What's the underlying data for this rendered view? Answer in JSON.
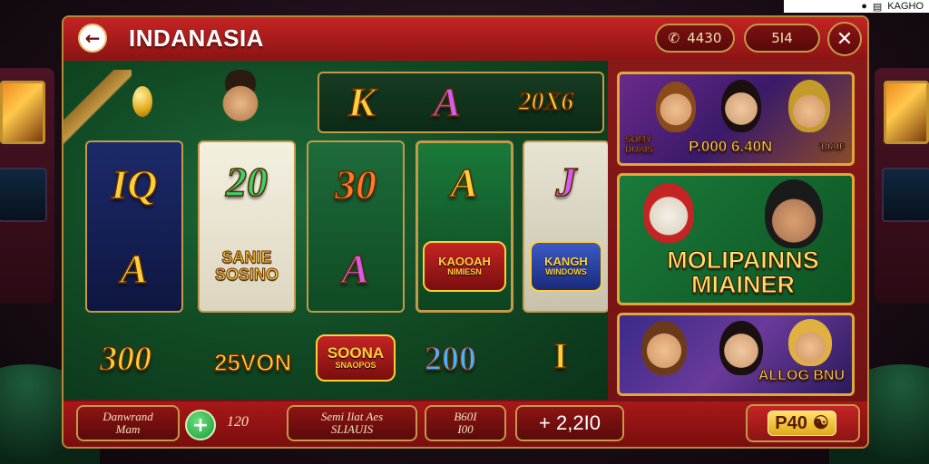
{
  "status_bar": {
    "text": "KAGHO"
  },
  "header": {
    "title": "INDANASIA",
    "phone_pill": "4430",
    "users_pill": "5I4",
    "icons": {
      "back": "back-arrow-icon",
      "close": "close-icon",
      "phone": "phone-icon",
      "user": "user-icon"
    }
  },
  "slot": {
    "top_row": [
      "K",
      "A",
      "20X6"
    ],
    "reels": [
      [
        "IQ",
        "A"
      ],
      [
        "20",
        "SANIE",
        "SOSINO"
      ],
      [
        "30",
        "A"
      ],
      [
        "A",
        "KAOOAH",
        "NIMIESN"
      ],
      [
        "J",
        "KANGH",
        "WINDOWS"
      ]
    ],
    "bottom_row": [
      "300",
      "25VON",
      "SOONA",
      "SNAOPOS",
      "200",
      "I"
    ]
  },
  "promos": [
    {
      "left_tag": "SOMY",
      "left_tag2": "DUAIS",
      "main": "P.000 6.40N",
      "right_tag": "'BIAIF"
    },
    {
      "main_line1": "MOLIPAINNS",
      "main_line2": "MIAINER"
    },
    {
      "main": "ALLOG BNU"
    }
  ],
  "footer": {
    "box1_line1": "Danwrand",
    "box1_line2": "Mam",
    "amount": "120",
    "box2_line1": "Semi Ilat Aes",
    "box2_line2": "SLIAUIS",
    "box3_line1": "B60I",
    "box3_line2": "I00",
    "box4": "+ 2,2I0",
    "p_button": "P40",
    "p_icon": "figure-icon"
  },
  "colors": {
    "frame_red": "#8b1a1a",
    "gold": "#c49a4a",
    "felt_green": "#1e6b3a"
  }
}
